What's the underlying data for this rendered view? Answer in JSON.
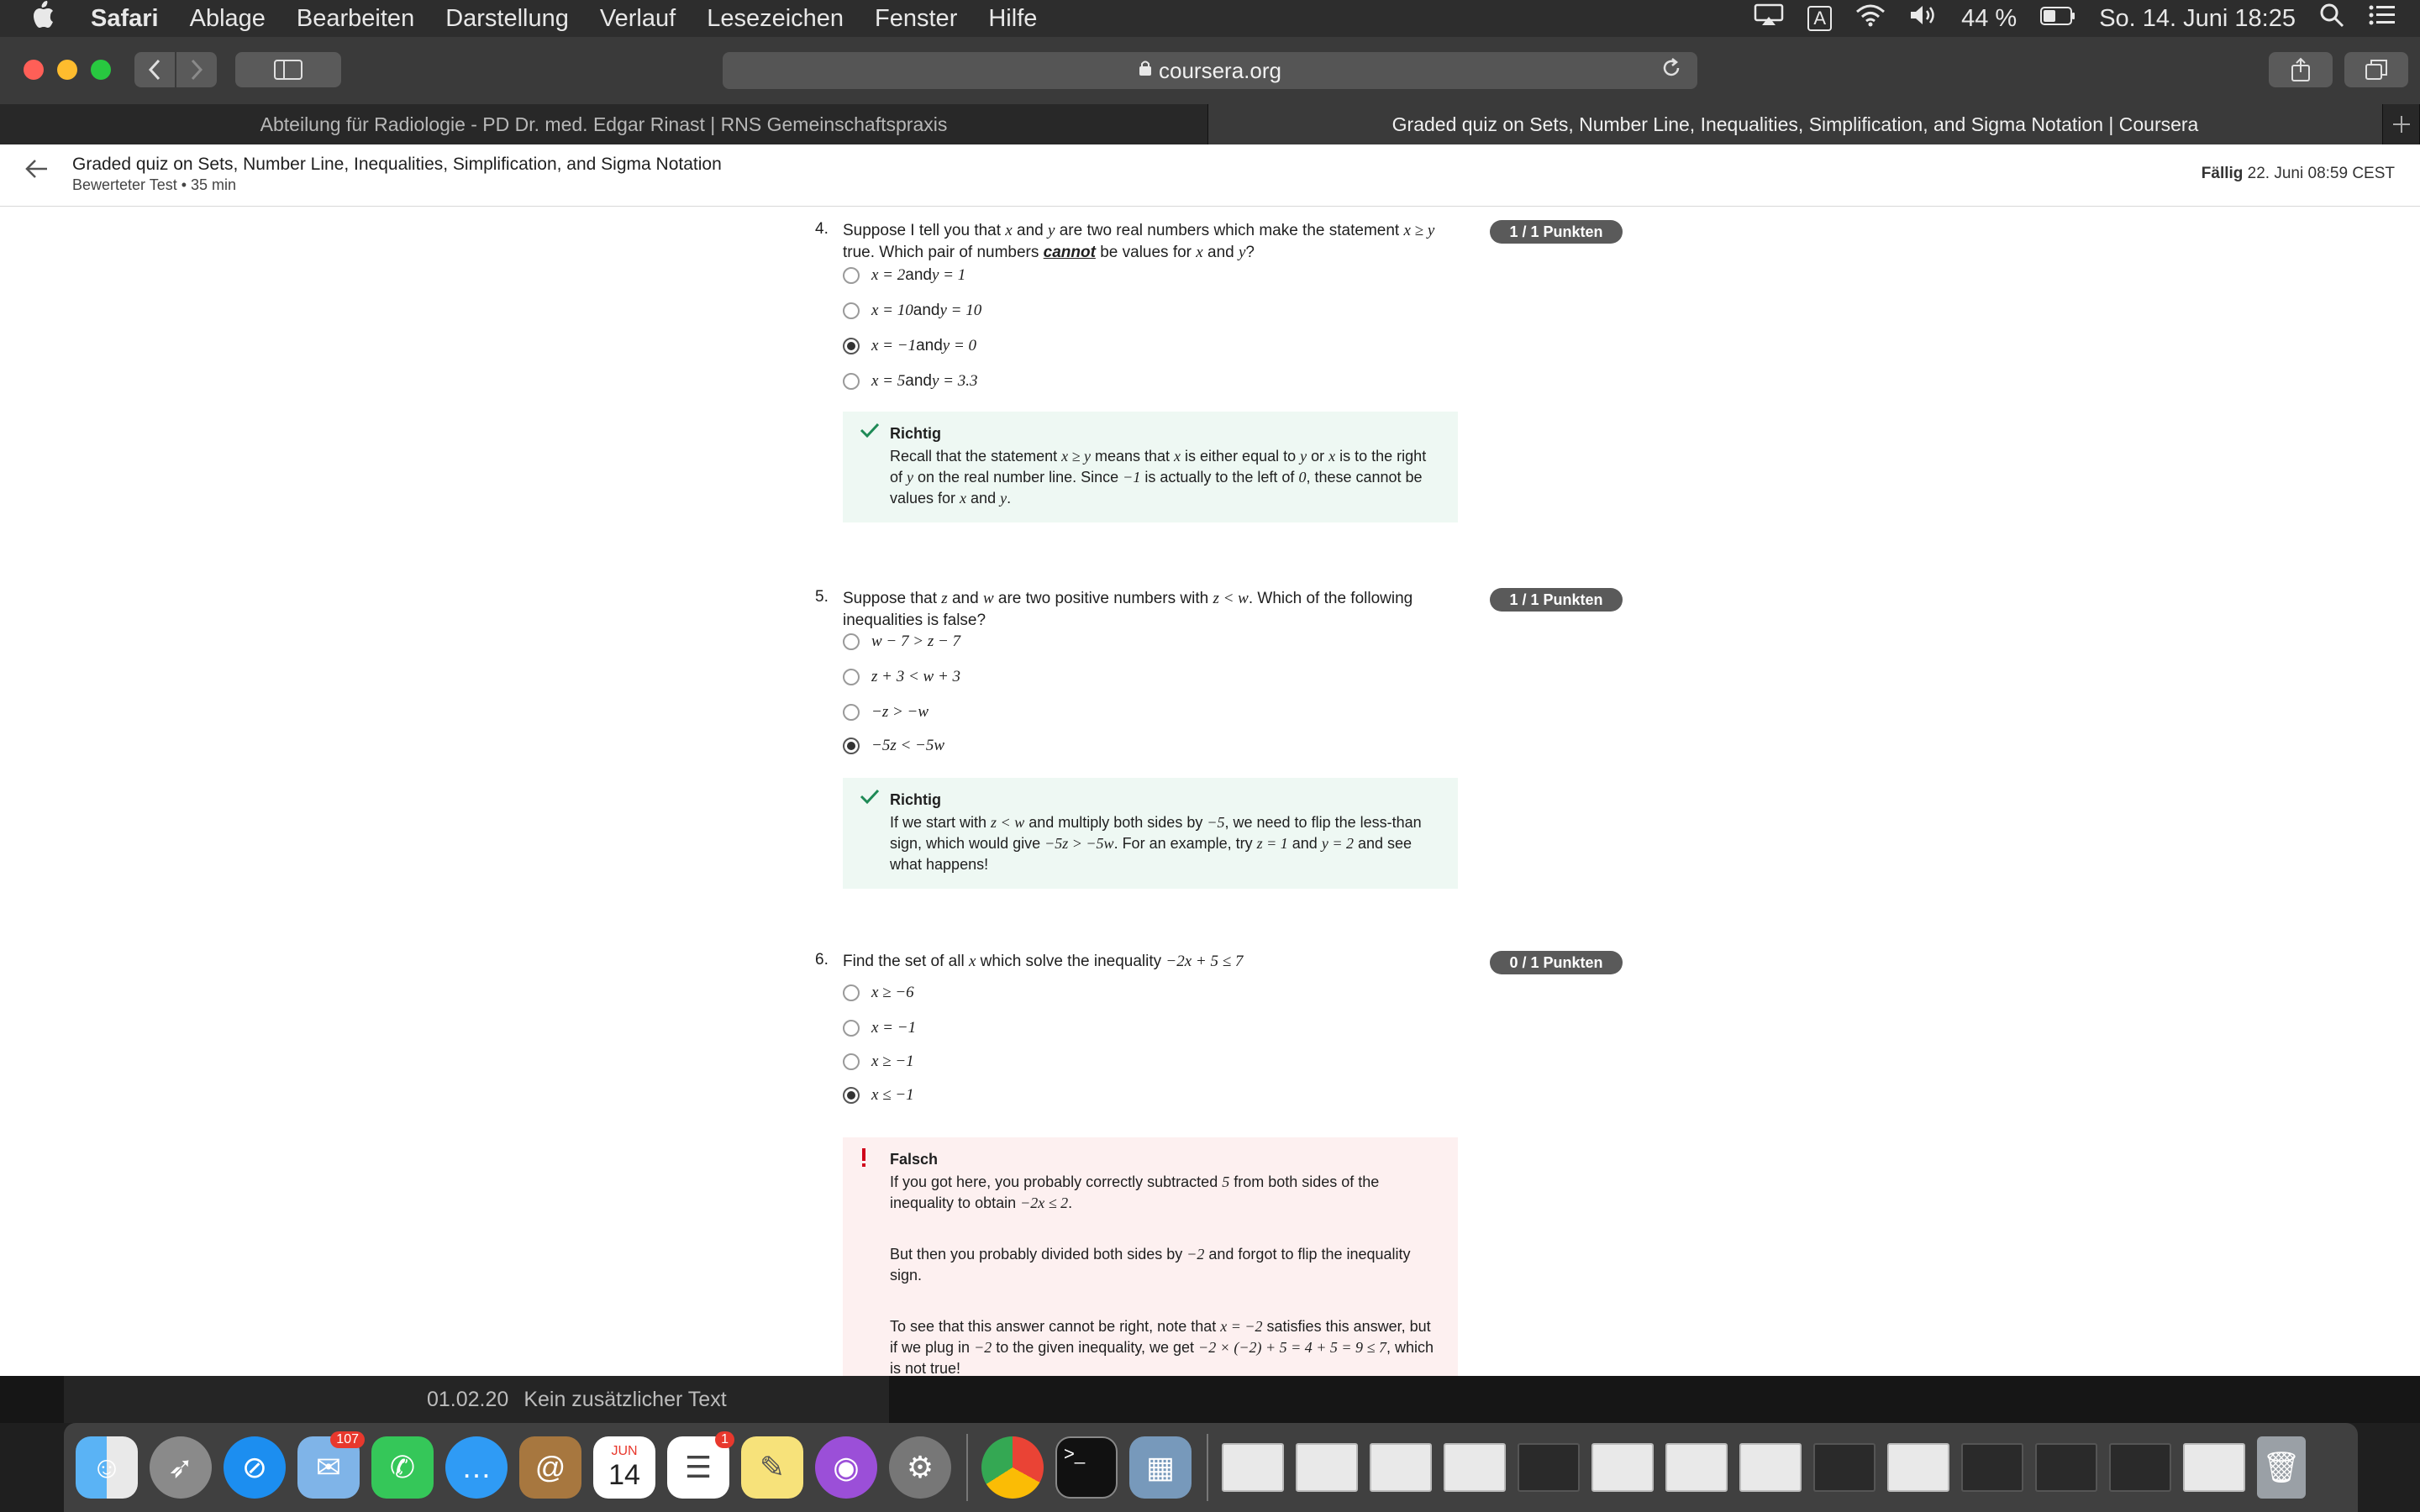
{
  "menubar": {
    "app": "Safari",
    "items": [
      "Ablage",
      "Bearbeiten",
      "Darstellung",
      "Verlauf",
      "Lesezeichen",
      "Fenster",
      "Hilfe"
    ],
    "input_indicator": "A",
    "battery": "44 %",
    "datetime": "So. 14. Juni  18:25"
  },
  "browser": {
    "url": "coursera.org",
    "tabs": [
      "Abteilung für Radiologie - PD Dr. med. Edgar Rinast | RNS Gemeinschaftspraxis",
      "Graded quiz on Sets, Number Line, Inequalities, Simplification, and Sigma Notation | Coursera"
    ]
  },
  "header": {
    "title": "Graded quiz on Sets, Number Line, Inequalities, Simplification, and Sigma Notation",
    "subtitle": "Bewerteter Test • 35 min",
    "due_label": "Fällig",
    "due_date": "22. Juni 08:59 CEST"
  },
  "questions": [
    {
      "number": "4.",
      "points": "1 / 1 Punkten",
      "text_before": "Suppose I tell you that ",
      "text_x": "x",
      "text_mid": " and ",
      "text_y": "y",
      "text_mid2": " are two real numbers which make the statement ",
      "text_stmt": "x ≥ y",
      "text_mid3": " true. Which pair of numbers ",
      "text_cannot": "cannot",
      "text_mid4": " be values for ",
      "text_x2": "x",
      "text_mid5": " and ",
      "text_y2": "y",
      "text_end": "?",
      "options": [
        {
          "a": "x = 2",
          "and": " and ",
          "b": "y = 1",
          "selected": false
        },
        {
          "a": "x = 10",
          "and": " and ",
          "b": "y = 10",
          "selected": false
        },
        {
          "a": "x = −1",
          "and": " and ",
          "b": "y = 0",
          "selected": true
        },
        {
          "a": "x = 5",
          "and": " and ",
          "b": "y = 3.3",
          "selected": false
        }
      ],
      "feedback": {
        "status": "Richtig",
        "p1_a": "Recall that the statement ",
        "p1_b": "x ≥ y",
        "p1_c": " means that ",
        "p1_d": "x",
        "p1_e": " is either equal to ",
        "p1_f": "y",
        "p1_g": " or ",
        "p1_h": "x",
        "p1_i": " is to the right of ",
        "p1_j": "y",
        "p1_k": " on the real number line. Since ",
        "p1_l": "−1",
        "p1_m": " is actually to the left of ",
        "p1_n": "0",
        "p1_o": ", these cannot be values for ",
        "p1_p": "x",
        "p1_q": " and ",
        "p1_r": "y",
        "p1_s": "."
      }
    },
    {
      "number": "5.",
      "points": "1 / 1 Punkten",
      "t1": "Suppose that ",
      "t2": "z",
      "t3": " and ",
      "t4": "w",
      "t5": " are two positive numbers with ",
      "t6": "z < w",
      "t7": ". Which of the following inequalities is false?",
      "options": [
        {
          "expr": "w − 7 > z − 7",
          "selected": false
        },
        {
          "expr": "z + 3 < w + 3",
          "selected": false
        },
        {
          "expr": "−z > −w",
          "selected": false
        },
        {
          "expr": "−5z < −5w",
          "selected": true
        }
      ],
      "feedback": {
        "status": "Richtig",
        "f1": "If we start with ",
        "f2": "z < w",
        "f3": " and multiply both sides by ",
        "f4": "−5",
        "f5": ", we need to flip the less-than sign, which would give ",
        "f6": "−5z > −5w",
        "f7": ". For an example, try ",
        "f8": "z = 1",
        "f9": " and ",
        "f10": "y = 2",
        "f11": " and see what happens!"
      }
    },
    {
      "number": "6.",
      "points": "0 / 1 Punkten",
      "t1": "Find the set of all ",
      "t2": "x",
      "t3": " which solve the inequality ",
      "t4": "−2x + 5 ≤ 7",
      "options": [
        {
          "expr": "x ≥ −6",
          "selected": false
        },
        {
          "expr": "x = −1",
          "selected": false
        },
        {
          "expr": "x ≥ −1",
          "selected": false
        },
        {
          "expr": "x ≤ −1",
          "selected": true
        }
      ],
      "feedback": {
        "status": "Falsch",
        "a1": "If you got here, you probably correctly subtracted ",
        "a2": "5",
        "a3": " from both sides of the inequality to obtain ",
        "a4": "−2x ≤ 2",
        "a5": ".",
        "b1": "But then you probably divided both sides by ",
        "b2": "−2",
        "b3": " and forgot to flip the inequality sign.",
        "c1": "To see that this answer cannot be right, note that ",
        "c2": "x = −2",
        "c3": " satisfies this answer, but if we plug in ",
        "c4": "−2",
        "c5": " to the given inequality, we get ",
        "c6": "−2 × (−2) + 5 = 4 + 5 = 9 ≤ 7",
        "c7": ", which is not true!"
      }
    }
  ],
  "notification": {
    "date": "01.02.20",
    "text": "Kein zusätzlicher Text"
  },
  "dock": {
    "mail_badge": "107",
    "calendar_month": "JUN",
    "calendar_day": "14",
    "reminders_badge": "1"
  }
}
